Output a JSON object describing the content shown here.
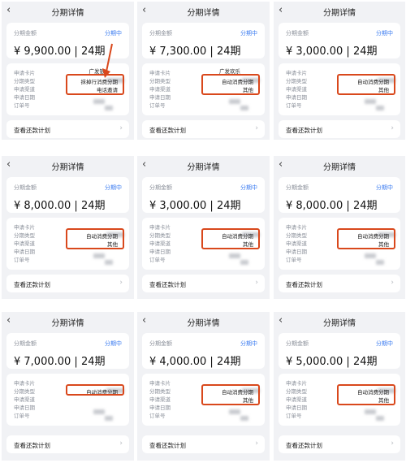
{
  "screen": {
    "title": "分期详情",
    "amount_label": "分期金额",
    "status": "分期中",
    "row_labels": [
      "申请卡片",
      "分期类型",
      "申请渠道",
      "申请日期",
      "订单号"
    ],
    "plan_link": "查看还款计划"
  },
  "panels": [
    {
      "amount": "¥ 9,900.00",
      "term": "24期",
      "card": "广发银",
      "type": "抹掉行消费分期",
      "channel": "电话邀请"
    },
    {
      "amount": "¥ 7,300.00",
      "term": "24期",
      "card": "广发欢乐",
      "type": "自动消费分期",
      "channel": "其他"
    },
    {
      "amount": "¥ 3,000.00",
      "term": "24期",
      "card": "",
      "type": "自动消费分期",
      "channel": "其他"
    },
    {
      "amount": "¥ 8,000.00",
      "term": "24期",
      "card": "",
      "type": "自动消费分期",
      "channel": "其他"
    },
    {
      "amount": "¥ 3,000.00",
      "term": "24期",
      "card": "",
      "type": "自动消费分期",
      "channel": "其他"
    },
    {
      "amount": "¥ 8,000.00",
      "term": "24期",
      "card": "",
      "type": "自动消费分期",
      "channel": "其他"
    },
    {
      "amount": "¥ 7,000.00",
      "term": "24期",
      "card": "",
      "type": "自动消费分期",
      "channel": ""
    },
    {
      "amount": "¥ 4,000.00",
      "term": "24期",
      "card": "",
      "type": "自动消费分期",
      "channel": "其他"
    },
    {
      "amount": "¥ 5,000.00",
      "term": "24期",
      "card": "",
      "type": "自动消费分期",
      "channel": "其他"
    }
  ],
  "colors": {
    "accent": "#3a7bf0",
    "highlight": "#d9481c",
    "background": "#f1f2f5"
  },
  "icons": {
    "back": "chevron-left-icon",
    "chevron": "chevron-right-icon",
    "arrow": "red-arrow-annotation"
  }
}
